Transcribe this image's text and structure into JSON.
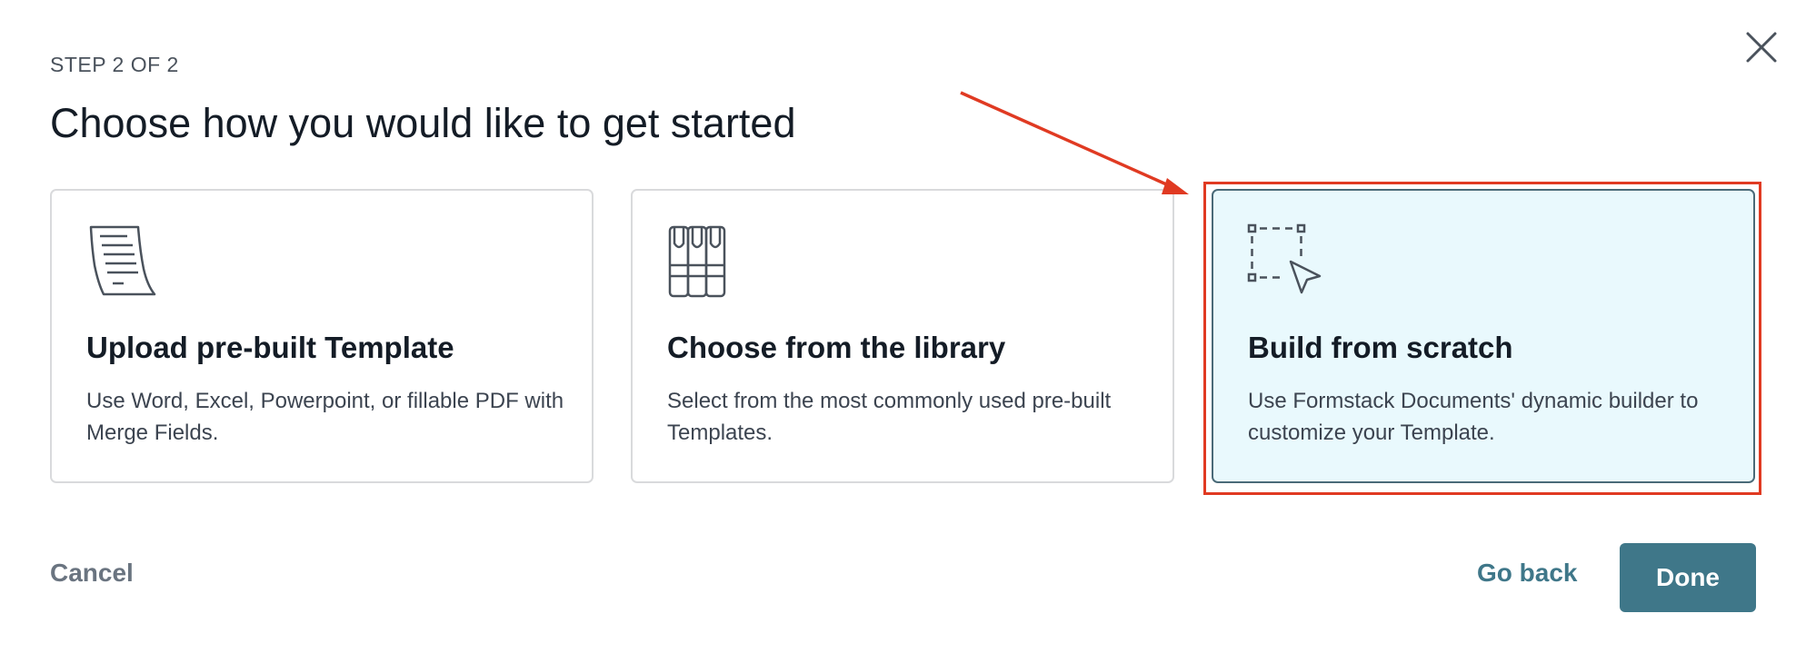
{
  "modal": {
    "step_label": "STEP 2 OF 2",
    "title": "Choose how you would like to get started"
  },
  "options": [
    {
      "title": "Upload pre-built Template",
      "description": "Use Word, Excel, Powerpoint, or fillable PDF with Merge Fields.",
      "icon": "document-icon",
      "selected": false
    },
    {
      "title": "Choose from the library",
      "description": "Select from the most commonly used pre-built Templates.",
      "icon": "library-books-icon",
      "selected": false
    },
    {
      "title": "Build from scratch",
      "description": "Use Formstack Documents' dynamic builder to customize your Template.",
      "icon": "select-cursor-icon",
      "selected": true
    }
  ],
  "footer": {
    "cancel_label": "Cancel",
    "go_back_label": "Go back",
    "done_label": "Done"
  },
  "colors": {
    "accent": "#3f7789",
    "selected_bg": "#e9f9fd",
    "annotation": "#e03a22"
  }
}
